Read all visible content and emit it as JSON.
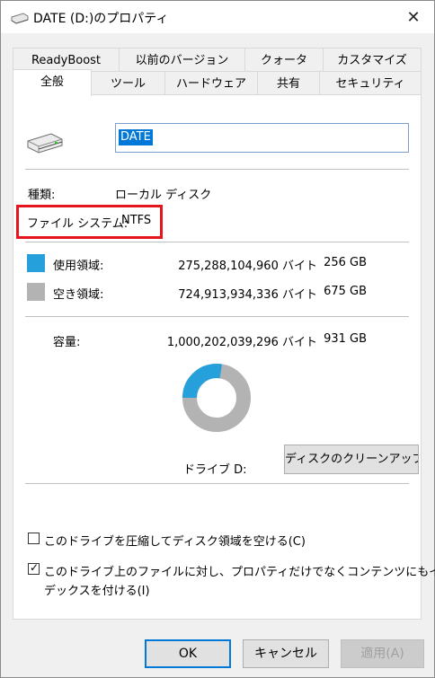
{
  "window": {
    "title": "DATE (D:)のプロパティ",
    "close_glyph": "✕"
  },
  "tabs": {
    "row1": [
      "ReadyBoost",
      "以前のバージョン",
      "クォータ",
      "カスタマイズ"
    ],
    "row2": [
      "全般",
      "ツール",
      "ハードウェア",
      "共有",
      "セキュリティ"
    ],
    "active": "全般"
  },
  "general": {
    "drive_name": "DATE",
    "type_label": "種類:",
    "type_value": "ローカル ディスク",
    "fs_label": "ファイル システム:",
    "fs_value": "NTFS",
    "used": {
      "label": "使用領域:",
      "bytes": "275,288,104,960 バイト",
      "size": "256 GB",
      "color": "#26a0da"
    },
    "free": {
      "label": "空き領域:",
      "bytes": "724,913,934,336 バイト",
      "size": "675 GB",
      "color": "#b3b3b3"
    },
    "capacity": {
      "label": "容量:",
      "bytes": "1,000,202,039,296 バイト",
      "size": "931 GB"
    },
    "used_fraction": 0.2752,
    "drive_label": "ドライブ D:",
    "cleanup_button": "ディスクのクリーンアップ(D)",
    "compress": {
      "label": "このドライブを圧縮してディスク領域を空ける(C)",
      "checked": false
    },
    "index": {
      "label_line1": "このドライブ上のファイルに対し、プロパティだけでなくコンテンツにもイン",
      "label_line2": "デックスを付ける(I)",
      "checked": true
    }
  },
  "buttons": {
    "ok": "OK",
    "cancel": "キャンセル",
    "apply": "適用(A)"
  },
  "accent_colors": {
    "highlight": "#e8141c",
    "selection": "#0078d7"
  }
}
